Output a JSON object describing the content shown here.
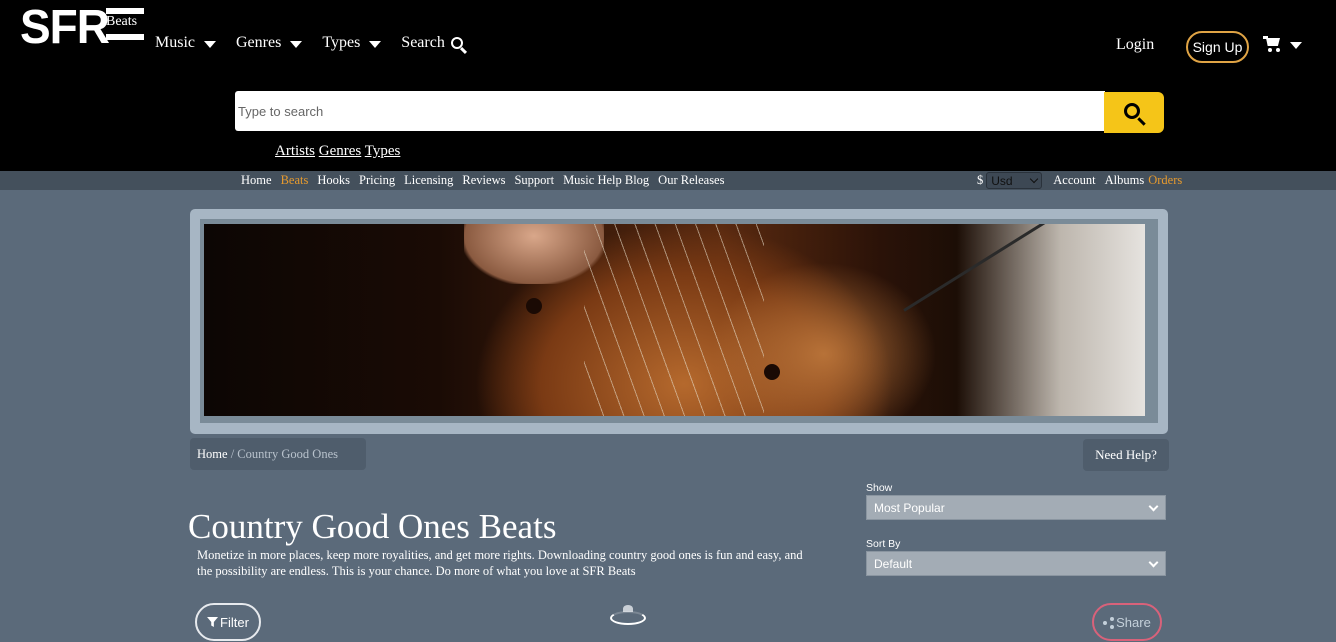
{
  "brand": {
    "logo_text": "SFR",
    "logo_sub": "Beats"
  },
  "header": {
    "nav": [
      {
        "label": "Music"
      },
      {
        "label": "Genres"
      },
      {
        "label": "Types"
      }
    ],
    "search_label": "Search",
    "login": "Login",
    "signup": "Sign Up"
  },
  "search": {
    "placeholder": "Type to search"
  },
  "quicklinks": [
    "Artists",
    "Genres",
    "Types"
  ],
  "subnav": {
    "left": [
      "Home",
      "Beats",
      "Hooks",
      "Pricing",
      "Licensing",
      "Reviews",
      "Support",
      "Music Help Blog",
      "Our Releases"
    ],
    "active": "Beats",
    "currency_symbol": "$",
    "currency_value": "Usd",
    "right": [
      "Account",
      "Albums",
      "Orders"
    ]
  },
  "breadcrumb": {
    "home": "Home",
    "separator": "/",
    "current": "Country Good Ones"
  },
  "help": "Need Help?",
  "page": {
    "title": "Country Good Ones Beats",
    "description": "Monetize in more places, keep more royalities, and get more rights. Downloading country good ones is fun and easy, and the possibility are endless. This is your chance. Do more of what you love at SFR Beats"
  },
  "controls": {
    "show_label": "Show",
    "show_value": "Most Popular",
    "sort_label": "Sort By",
    "sort_value": "Default",
    "filter": "Filter",
    "share": "Share"
  },
  "colors": {
    "accent_orange": "#e69a2e",
    "search_button": "#f5c518",
    "signup_border": "#e0a445",
    "share_border": "#d9627a"
  }
}
